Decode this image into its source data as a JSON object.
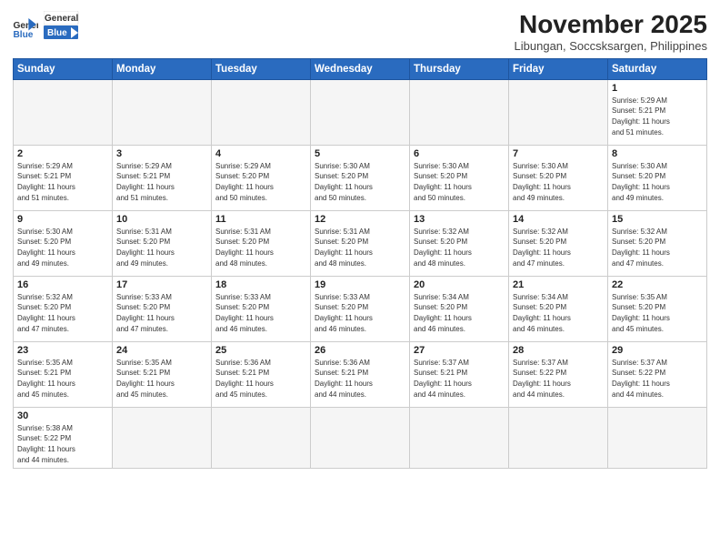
{
  "logo": {
    "line1": "General",
    "line2": "Blue"
  },
  "title": "November 2025",
  "location": "Libungan, Soccsksargen, Philippines",
  "weekdays": [
    "Sunday",
    "Monday",
    "Tuesday",
    "Wednesday",
    "Thursday",
    "Friday",
    "Saturday"
  ],
  "weeks": [
    [
      {
        "day": "",
        "info": ""
      },
      {
        "day": "",
        "info": ""
      },
      {
        "day": "",
        "info": ""
      },
      {
        "day": "",
        "info": ""
      },
      {
        "day": "",
        "info": ""
      },
      {
        "day": "",
        "info": ""
      },
      {
        "day": "1",
        "info": "Sunrise: 5:29 AM\nSunset: 5:21 PM\nDaylight: 11 hours\nand 51 minutes."
      }
    ],
    [
      {
        "day": "2",
        "info": "Sunrise: 5:29 AM\nSunset: 5:21 PM\nDaylight: 11 hours\nand 51 minutes."
      },
      {
        "day": "3",
        "info": "Sunrise: 5:29 AM\nSunset: 5:21 PM\nDaylight: 11 hours\nand 51 minutes."
      },
      {
        "day": "4",
        "info": "Sunrise: 5:29 AM\nSunset: 5:20 PM\nDaylight: 11 hours\nand 50 minutes."
      },
      {
        "day": "5",
        "info": "Sunrise: 5:30 AM\nSunset: 5:20 PM\nDaylight: 11 hours\nand 50 minutes."
      },
      {
        "day": "6",
        "info": "Sunrise: 5:30 AM\nSunset: 5:20 PM\nDaylight: 11 hours\nand 50 minutes."
      },
      {
        "day": "7",
        "info": "Sunrise: 5:30 AM\nSunset: 5:20 PM\nDaylight: 11 hours\nand 49 minutes."
      },
      {
        "day": "8",
        "info": "Sunrise: 5:30 AM\nSunset: 5:20 PM\nDaylight: 11 hours\nand 49 minutes."
      }
    ],
    [
      {
        "day": "9",
        "info": "Sunrise: 5:30 AM\nSunset: 5:20 PM\nDaylight: 11 hours\nand 49 minutes."
      },
      {
        "day": "10",
        "info": "Sunrise: 5:31 AM\nSunset: 5:20 PM\nDaylight: 11 hours\nand 49 minutes."
      },
      {
        "day": "11",
        "info": "Sunrise: 5:31 AM\nSunset: 5:20 PM\nDaylight: 11 hours\nand 48 minutes."
      },
      {
        "day": "12",
        "info": "Sunrise: 5:31 AM\nSunset: 5:20 PM\nDaylight: 11 hours\nand 48 minutes."
      },
      {
        "day": "13",
        "info": "Sunrise: 5:32 AM\nSunset: 5:20 PM\nDaylight: 11 hours\nand 48 minutes."
      },
      {
        "day": "14",
        "info": "Sunrise: 5:32 AM\nSunset: 5:20 PM\nDaylight: 11 hours\nand 47 minutes."
      },
      {
        "day": "15",
        "info": "Sunrise: 5:32 AM\nSunset: 5:20 PM\nDaylight: 11 hours\nand 47 minutes."
      }
    ],
    [
      {
        "day": "16",
        "info": "Sunrise: 5:32 AM\nSunset: 5:20 PM\nDaylight: 11 hours\nand 47 minutes."
      },
      {
        "day": "17",
        "info": "Sunrise: 5:33 AM\nSunset: 5:20 PM\nDaylight: 11 hours\nand 47 minutes."
      },
      {
        "day": "18",
        "info": "Sunrise: 5:33 AM\nSunset: 5:20 PM\nDaylight: 11 hours\nand 46 minutes."
      },
      {
        "day": "19",
        "info": "Sunrise: 5:33 AM\nSunset: 5:20 PM\nDaylight: 11 hours\nand 46 minutes."
      },
      {
        "day": "20",
        "info": "Sunrise: 5:34 AM\nSunset: 5:20 PM\nDaylight: 11 hours\nand 46 minutes."
      },
      {
        "day": "21",
        "info": "Sunrise: 5:34 AM\nSunset: 5:20 PM\nDaylight: 11 hours\nand 46 minutes."
      },
      {
        "day": "22",
        "info": "Sunrise: 5:35 AM\nSunset: 5:20 PM\nDaylight: 11 hours\nand 45 minutes."
      }
    ],
    [
      {
        "day": "23",
        "info": "Sunrise: 5:35 AM\nSunset: 5:21 PM\nDaylight: 11 hours\nand 45 minutes."
      },
      {
        "day": "24",
        "info": "Sunrise: 5:35 AM\nSunset: 5:21 PM\nDaylight: 11 hours\nand 45 minutes."
      },
      {
        "day": "25",
        "info": "Sunrise: 5:36 AM\nSunset: 5:21 PM\nDaylight: 11 hours\nand 45 minutes."
      },
      {
        "day": "26",
        "info": "Sunrise: 5:36 AM\nSunset: 5:21 PM\nDaylight: 11 hours\nand 44 minutes."
      },
      {
        "day": "27",
        "info": "Sunrise: 5:37 AM\nSunset: 5:21 PM\nDaylight: 11 hours\nand 44 minutes."
      },
      {
        "day": "28",
        "info": "Sunrise: 5:37 AM\nSunset: 5:22 PM\nDaylight: 11 hours\nand 44 minutes."
      },
      {
        "day": "29",
        "info": "Sunrise: 5:37 AM\nSunset: 5:22 PM\nDaylight: 11 hours\nand 44 minutes."
      }
    ],
    [
      {
        "day": "30",
        "info": "Sunrise: 5:38 AM\nSunset: 5:22 PM\nDaylight: 11 hours\nand 44 minutes."
      },
      {
        "day": "",
        "info": ""
      },
      {
        "day": "",
        "info": ""
      },
      {
        "day": "",
        "info": ""
      },
      {
        "day": "",
        "info": ""
      },
      {
        "day": "",
        "info": ""
      },
      {
        "day": "",
        "info": ""
      }
    ]
  ]
}
